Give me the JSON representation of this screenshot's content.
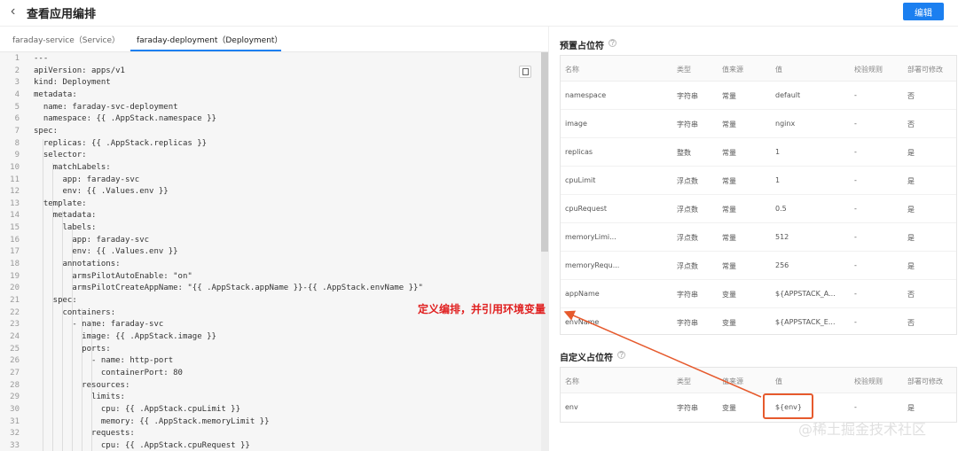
{
  "header": {
    "title": "查看应用编排",
    "edit_label": "编辑"
  },
  "tabs": [
    {
      "label": "faraday-service（Service）"
    },
    {
      "label": "faraday-deployment（Deployment）"
    }
  ],
  "code_lines": [
    "---",
    "apiVersion: apps/v1",
    "kind: Deployment",
    "metadata:",
    "  name: faraday-svc-deployment",
    "  namespace: {{ .AppStack.namespace }}",
    "spec:",
    "  replicas: {{ .AppStack.replicas }}",
    "  selector:",
    "    matchLabels:",
    "      app: faraday-svc",
    "      env: {{ .Values.env }}",
    "  template:",
    "    metadata:",
    "      labels:",
    "        app: faraday-svc",
    "        env: {{ .Values.env }}",
    "      annotations:",
    "        armsPilotAutoEnable: \"on\"",
    "        armsPilotCreateAppName: \"{{ .AppStack.appName }}-{{ .AppStack.envName }}\"",
    "    spec:",
    "      containers:",
    "        - name: faraday-svc",
    "          image: {{ .AppStack.image }}",
    "          ports:",
    "            - name: http-port",
    "              containerPort: 80",
    "          resources:",
    "            limits:",
    "              cpu: {{ .AppStack.cpuLimit }}",
    "              memory: {{ .AppStack.memoryLimit }}",
    "            requests:",
    "              cpu: {{ .AppStack.cpuRequest }}"
  ],
  "preset": {
    "title": "预置占位符",
    "columns": [
      "名称",
      "类型",
      "值来源",
      "值",
      "校验规则",
      "部署可修改"
    ],
    "rows": [
      [
        "namespace",
        "字符串",
        "常量",
        "default",
        "-",
        "否"
      ],
      [
        "image",
        "字符串",
        "常量",
        "nginx",
        "-",
        "否"
      ],
      [
        "replicas",
        "整数",
        "常量",
        "1",
        "-",
        "是"
      ],
      [
        "cpuLimit",
        "浮点数",
        "常量",
        "1",
        "-",
        "是"
      ],
      [
        "cpuRequest",
        "浮点数",
        "常量",
        "0.5",
        "-",
        "是"
      ],
      [
        "memoryLimi...",
        "浮点数",
        "常量",
        "512",
        "-",
        "是"
      ],
      [
        "memoryRequ...",
        "浮点数",
        "常量",
        "256",
        "-",
        "是"
      ],
      [
        "appName",
        "字符串",
        "变量",
        "${APPSTACK_A...",
        "-",
        "否"
      ],
      [
        "envName",
        "字符串",
        "变量",
        "${APPSTACK_E...",
        "-",
        "否"
      ]
    ]
  },
  "custom": {
    "title": "自定义占位符",
    "columns": [
      "名称",
      "类型",
      "值来源",
      "值",
      "校验规则",
      "部署可修改"
    ],
    "rows": [
      [
        "env",
        "字符串",
        "变量",
        "${env}",
        "-",
        "是"
      ]
    ]
  },
  "annotation": "定义编排，并引用环境变量",
  "watermark": "@稀土掘金技术社区",
  "colors": {
    "accent": "#1b7ff0",
    "annotation": "#e02020",
    "highlight_box": "#e65a2d"
  }
}
